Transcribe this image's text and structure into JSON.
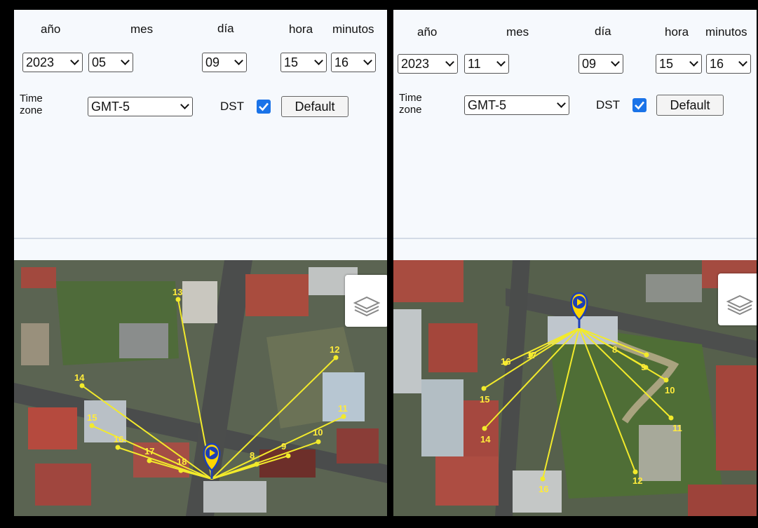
{
  "panels": [
    {
      "labels": {
        "year": "año",
        "month": "mes",
        "day": "día",
        "hour": "hora",
        "minutes": "minutos"
      },
      "year": "2023",
      "month": "05",
      "day": "09",
      "hour": "15",
      "minute": "16",
      "tz_label_line1": "Time",
      "tz_label_line2": "zone",
      "timezone": "GMT-5",
      "dst_label": "DST",
      "dst_checked": true,
      "default_button": "Default",
      "hour_labels": [
        {
          "text": "14"
        },
        {
          "text": "13"
        },
        {
          "text": "12"
        },
        {
          "text": "11"
        },
        {
          "text": "10"
        },
        {
          "text": "9"
        },
        {
          "text": "8"
        },
        {
          "text": "15"
        },
        {
          "text": "16"
        },
        {
          "text": "17"
        },
        {
          "text": "18"
        }
      ]
    },
    {
      "labels": {
        "year": "año",
        "month": "mes",
        "day": "día",
        "hour": "hora",
        "minutes": "minutos"
      },
      "year": "2023",
      "month": "11",
      "day": "09",
      "hour": "15",
      "minute": "16",
      "tz_label_line1": "Time",
      "tz_label_line2": "zone",
      "timezone": "GMT-5",
      "dst_label": "DST",
      "dst_checked": true,
      "default_button": "Default",
      "hour_labels": [
        {
          "text": "8"
        },
        {
          "text": "9"
        },
        {
          "text": "10"
        },
        {
          "text": "11"
        },
        {
          "text": "12"
        },
        {
          "text": "16"
        },
        {
          "text": "14"
        },
        {
          "text": "15"
        },
        {
          "text": "16"
        },
        {
          "text": "17"
        }
      ]
    }
  ],
  "colors": {
    "sun_line": "#f2ea2b",
    "marker": "#1e3fb5",
    "marker_ring": "#ffd600",
    "checkbox": "#1a73e8"
  },
  "icons": {
    "layers": "layers-icon",
    "marker": "location-pin-icon",
    "checkbox": "checkmark-icon"
  }
}
